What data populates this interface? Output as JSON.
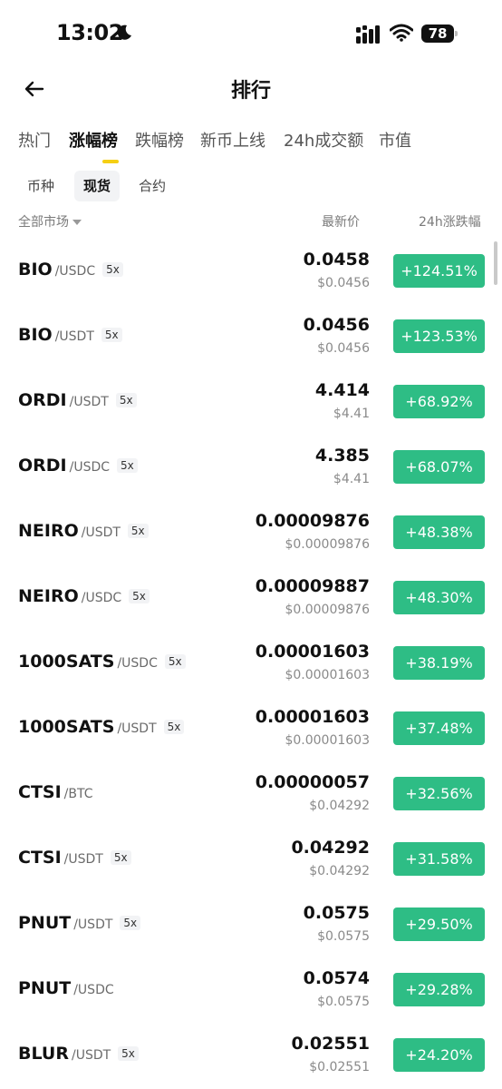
{
  "status_bar": {
    "time": "13:02",
    "battery": "78"
  },
  "header": {
    "title": "排行"
  },
  "tabs": [
    {
      "label": "热门",
      "active": false
    },
    {
      "label": "涨幅榜",
      "active": true
    },
    {
      "label": "跌幅榜",
      "active": false
    },
    {
      "label": "新币上线",
      "active": false
    },
    {
      "label": "24h成交额",
      "active": false
    },
    {
      "label": "市值",
      "active": false
    }
  ],
  "subtabs": [
    {
      "label": "币种",
      "active": false
    },
    {
      "label": "现货",
      "active": true
    },
    {
      "label": "合约",
      "active": false
    }
  ],
  "columns": {
    "market": "全部市场",
    "price": "最新价",
    "change": "24h涨跌幅"
  },
  "colors": {
    "up": "#2ebd85",
    "accent": "#f5cf14"
  },
  "rows": [
    {
      "base": "BIO",
      "quote": "/USDC",
      "lev": "5x",
      "price": "0.0458",
      "usd": "$0.0456",
      "change": "+124.51%"
    },
    {
      "base": "BIO",
      "quote": "/USDT",
      "lev": "5x",
      "price": "0.0456",
      "usd": "$0.0456",
      "change": "+123.53%"
    },
    {
      "base": "ORDI",
      "quote": "/USDT",
      "lev": "5x",
      "price": "4.414",
      "usd": "$4.41",
      "change": "+68.92%"
    },
    {
      "base": "ORDI",
      "quote": "/USDC",
      "lev": "5x",
      "price": "4.385",
      "usd": "$4.41",
      "change": "+68.07%"
    },
    {
      "base": "NEIRO",
      "quote": "/USDT",
      "lev": "5x",
      "price": "0.00009876",
      "usd": "$0.00009876",
      "change": "+48.38%"
    },
    {
      "base": "NEIRO",
      "quote": "/USDC",
      "lev": "5x",
      "price": "0.00009887",
      "usd": "$0.00009876",
      "change": "+48.30%"
    },
    {
      "base": "1000SATS",
      "quote": "/USDC",
      "lev": "5x",
      "price": "0.00001603",
      "usd": "$0.00001603",
      "change": "+38.19%"
    },
    {
      "base": "1000SATS",
      "quote": "/USDT",
      "lev": "5x",
      "price": "0.00001603",
      "usd": "$0.00001603",
      "change": "+37.48%"
    },
    {
      "base": "CTSI",
      "quote": "/BTC",
      "lev": "",
      "price": "0.00000057",
      "usd": "$0.04292",
      "change": "+32.56%"
    },
    {
      "base": "CTSI",
      "quote": "/USDT",
      "lev": "5x",
      "price": "0.04292",
      "usd": "$0.04292",
      "change": "+31.58%"
    },
    {
      "base": "PNUT",
      "quote": "/USDT",
      "lev": "5x",
      "price": "0.0575",
      "usd": "$0.0575",
      "change": "+29.50%"
    },
    {
      "base": "PNUT",
      "quote": "/USDC",
      "lev": "",
      "price": "0.0574",
      "usd": "$0.0575",
      "change": "+29.28%"
    },
    {
      "base": "BLUR",
      "quote": "/USDT",
      "lev": "5x",
      "price": "0.02551",
      "usd": "$0.02551",
      "change": "+24.20%"
    }
  ]
}
